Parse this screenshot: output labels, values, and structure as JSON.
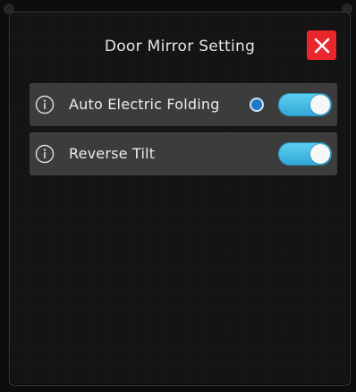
{
  "dialog": {
    "title": "Door Mirror Setting"
  },
  "icons": {
    "close": "close-icon",
    "info": "info-icon"
  },
  "colors": {
    "close_button": "#e8262c",
    "toggle_on": "#3bbbe6",
    "indicator_dot": "#1f78c8",
    "row_background": "#3c3c3c"
  },
  "settings": [
    {
      "label": "Auto Electric Folding",
      "enabled": true,
      "has_indicator": true
    },
    {
      "label": "Reverse Tilt",
      "enabled": true,
      "has_indicator": false
    }
  ]
}
